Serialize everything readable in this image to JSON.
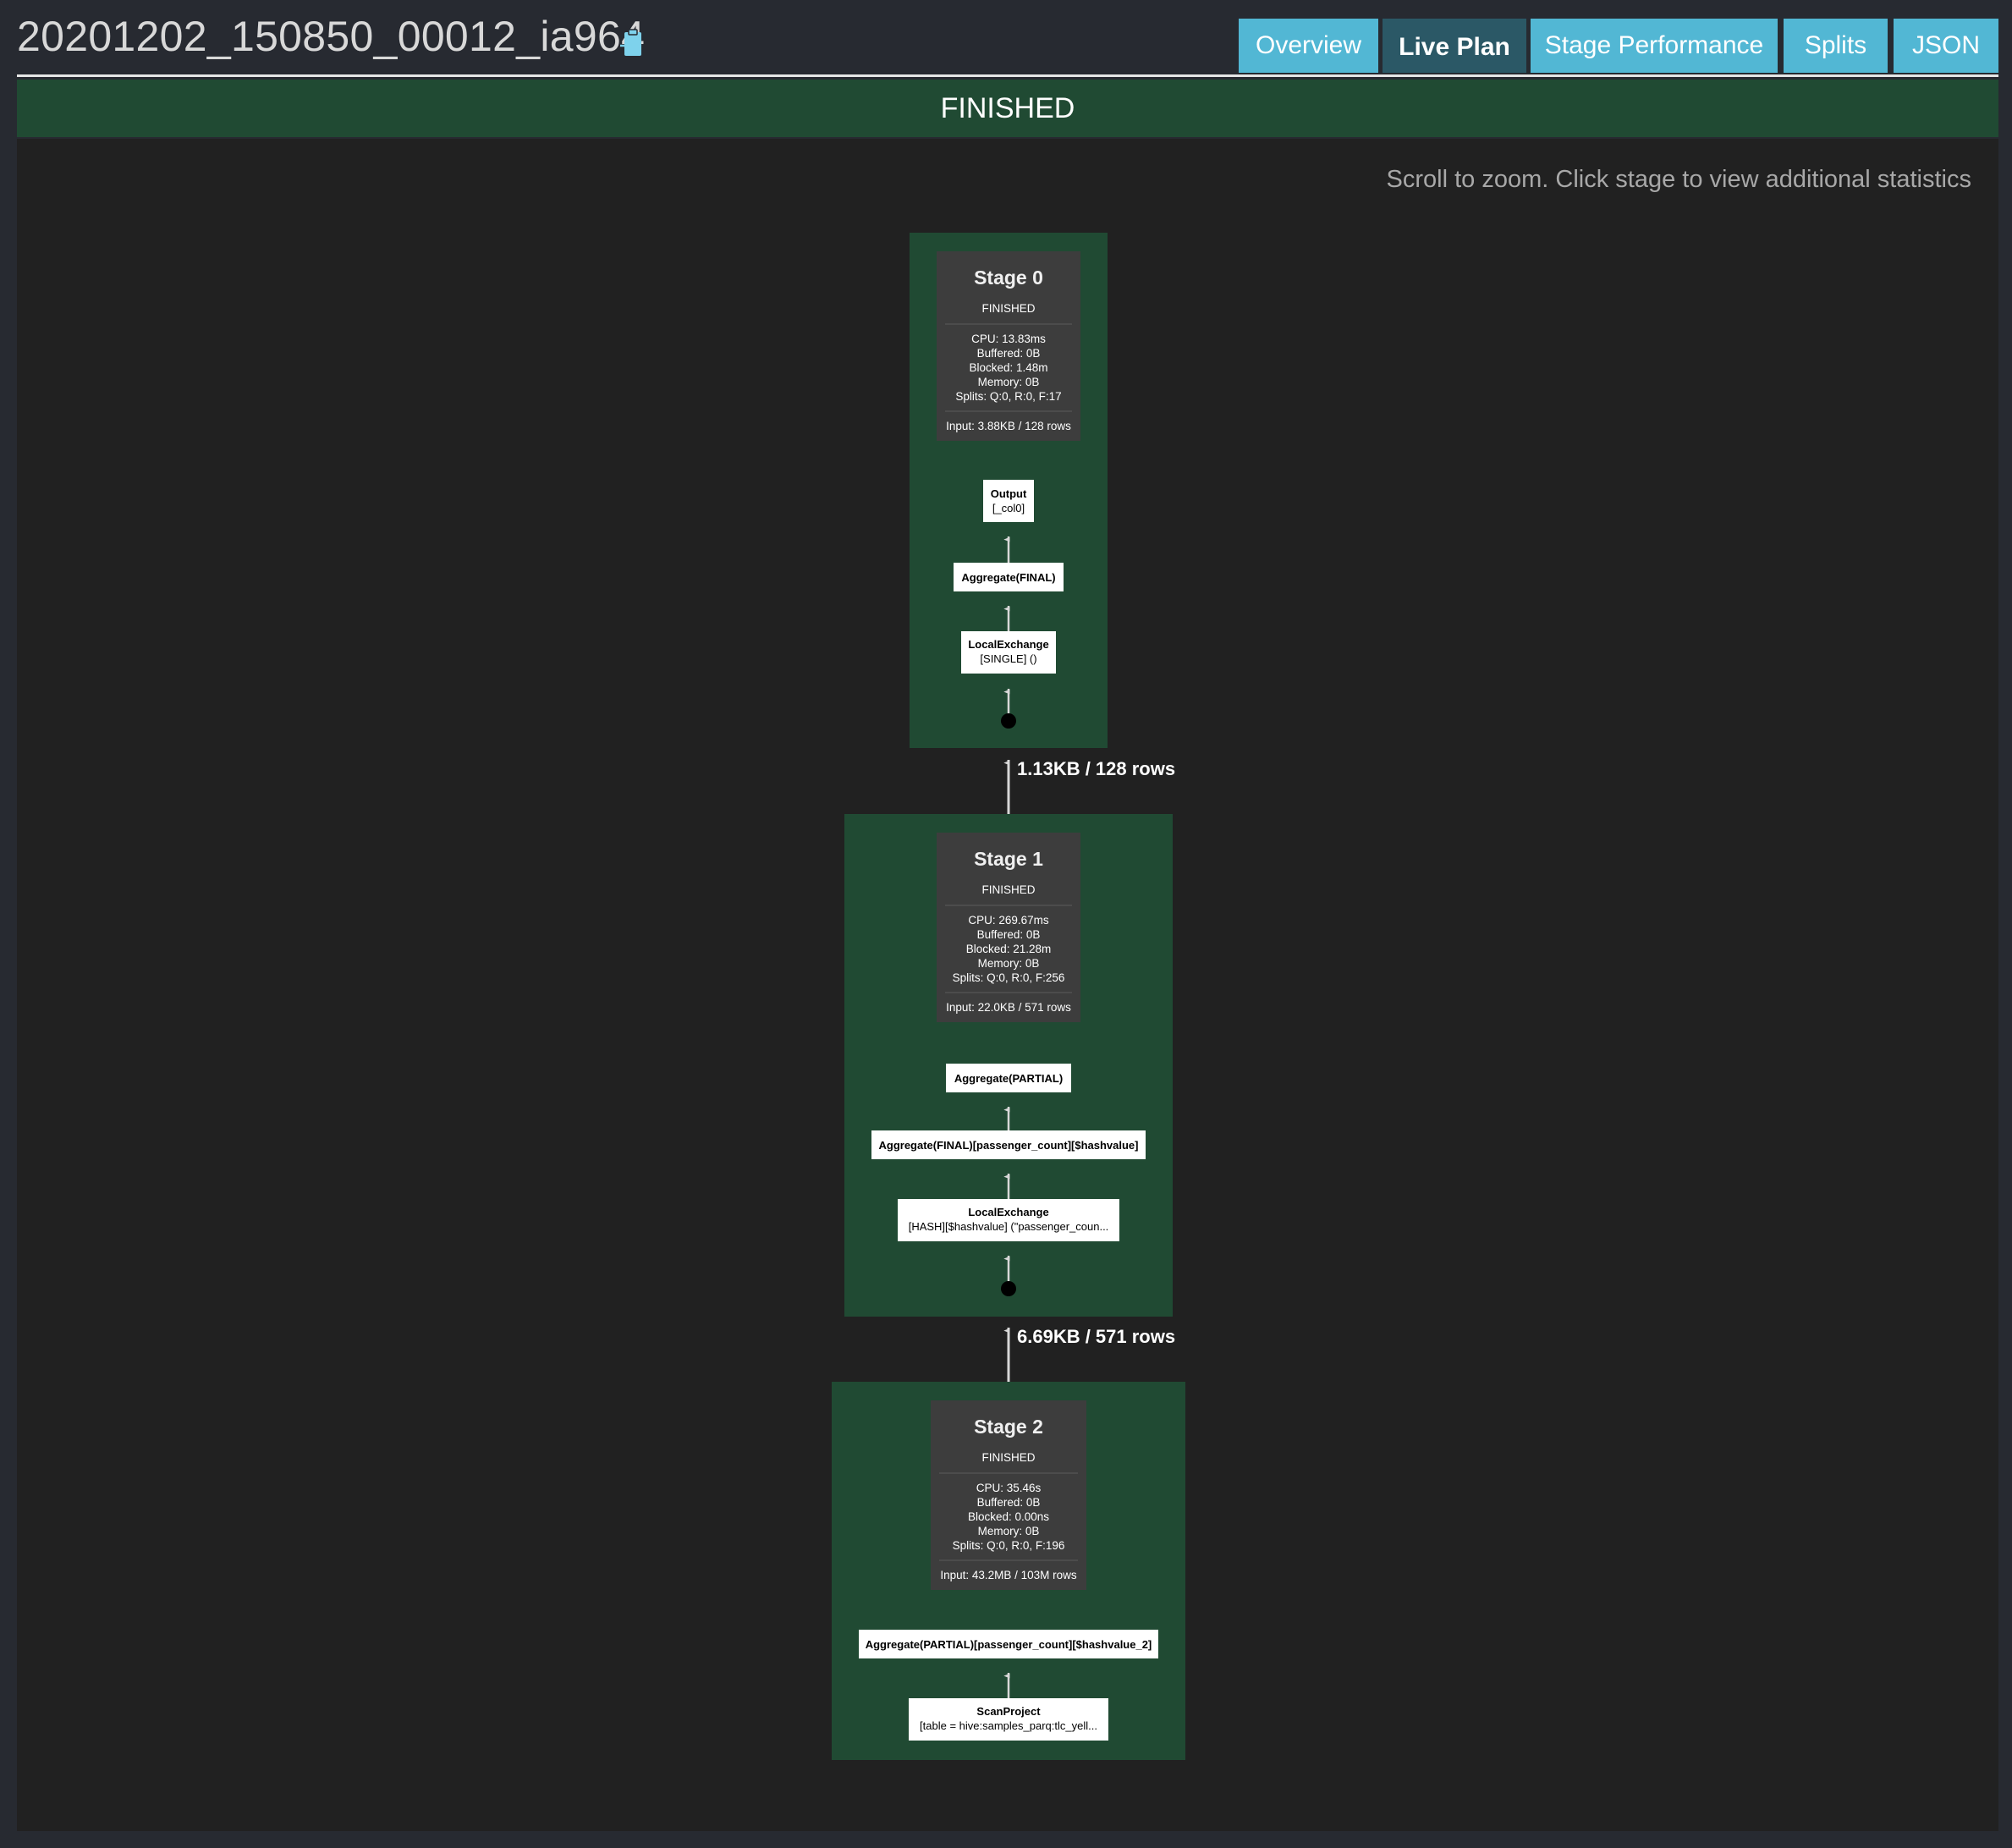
{
  "header": {
    "query_id": "20201202_150850_00012_ia964",
    "copy_icon": "clipboard-icon"
  },
  "tabs": [
    {
      "label": "Overview",
      "active": false
    },
    {
      "label": "Live Plan",
      "active": true
    },
    {
      "label": "Stage Performance",
      "active": false
    },
    {
      "label": "Splits",
      "active": false
    },
    {
      "label": "JSON",
      "active": false
    }
  ],
  "state": "FINISHED",
  "hint": "Scroll to zoom. Click stage to view additional statistics",
  "colors": {
    "stage_background": "#204a33",
    "stage_card": "#3d3d3d",
    "tab": "#52b7d4",
    "tab_active": "#2b5866"
  },
  "stages": [
    {
      "title": "Stage 0",
      "state": "FINISHED",
      "cpu": "CPU: 13.83ms",
      "buffered": "Buffered: 0B",
      "blocked": "Blocked: 1.48m",
      "memory": "Memory: 0B",
      "splits": "Splits: Q:0, R:0, F:17",
      "input": "Input: 3.88KB / 128 rows",
      "operators": [
        {
          "title": "Output",
          "detail": "[_col0]"
        },
        {
          "title": "Aggregate(FINAL)",
          "detail": ""
        },
        {
          "title": "LocalExchange",
          "detail": "[SINGLE] ()"
        }
      ]
    },
    {
      "title": "Stage 1",
      "state": "FINISHED",
      "cpu": "CPU: 269.67ms",
      "buffered": "Buffered: 0B",
      "blocked": "Blocked: 21.28m",
      "memory": "Memory: 0B",
      "splits": "Splits: Q:0, R:0, F:256",
      "input": "Input: 22.0KB / 571 rows",
      "operators": [
        {
          "title": "Aggregate(PARTIAL)",
          "detail": ""
        },
        {
          "title": "Aggregate(FINAL)[passenger_count][$hashvalue]",
          "detail": ""
        },
        {
          "title": "LocalExchange",
          "detail": "[HASH][$hashvalue] (\"passenger_coun..."
        }
      ]
    },
    {
      "title": "Stage 2",
      "state": "FINISHED",
      "cpu": "CPU: 35.46s",
      "buffered": "Buffered: 0B",
      "blocked": "Blocked: 0.00ns",
      "memory": "Memory: 0B",
      "splits": "Splits: Q:0, R:0, F:196",
      "input": "Input: 43.2MB / 103M rows",
      "operators": [
        {
          "title": "Aggregate(PARTIAL)[passenger_count][$hashvalue_2]",
          "detail": ""
        },
        {
          "title": "ScanProject",
          "detail": "[table = hive:samples_parq:tlc_yell..."
        }
      ]
    }
  ],
  "edges": [
    {
      "label": "1.13KB / 128 rows"
    },
    {
      "label": "6.69KB / 571 rows"
    }
  ]
}
